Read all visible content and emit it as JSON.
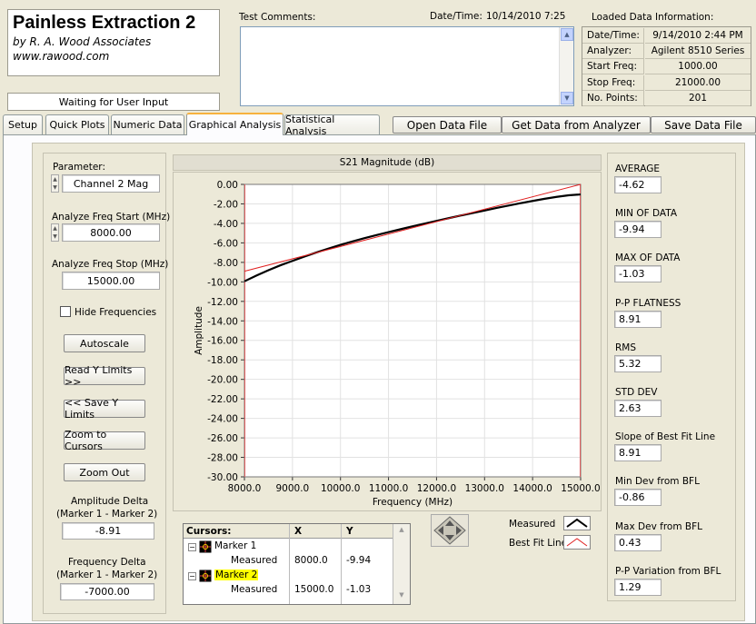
{
  "app": {
    "title": "Painless Extraction 2",
    "by": "by R. A. Wood Associates",
    "url": "www.rawood.com",
    "status": "Waiting for User Input"
  },
  "header": {
    "comments_label": "Test Comments:",
    "datetime_label": "Date/Time:",
    "datetime_value": "10/14/2010  7:25",
    "loaded_title": "Loaded Data Information:"
  },
  "loaded": [
    {
      "k": "Date/Time:",
      "v": "9/14/2010 2:44 PM"
    },
    {
      "k": "Analyzer:",
      "v": "Agilent 8510 Series"
    },
    {
      "k": "Start Freq:",
      "v": "1000.00"
    },
    {
      "k": "Stop Freq:",
      "v": "21000.00"
    },
    {
      "k": "No. Points:",
      "v": "201"
    }
  ],
  "tabs": [
    "Setup",
    "Quick Plots",
    "Numeric Data",
    "Graphical Analysis",
    "Statistical Analysis"
  ],
  "toolbar": {
    "open": "Open Data File",
    "get": "Get Data from Analyzer",
    "save": "Save Data File"
  },
  "left": {
    "param_label": "Parameter:",
    "param_value": "Channel 2 Mag",
    "start_label": "Analyze Freq Start (MHz)",
    "start_value": "8000.00",
    "stop_label": "Analyze Freq Stop (MHz)",
    "stop_value": "15000.00",
    "hide": "Hide Frequencies",
    "autoscale": "Autoscale",
    "read_y": "Read Y Limits >>",
    "save_y": "<< Save Y Limits",
    "zoom_cursors": "Zoom to Cursors",
    "zoom_out": "Zoom Out",
    "amp_delta_label1": "Amplitude Delta",
    "amp_delta_label2": "(Marker 1 - Marker 2)",
    "amp_delta": "-8.91",
    "freq_delta_label1": "Frequency Delta",
    "freq_delta_label2": "(Marker 1 - Marker 2)",
    "freq_delta": "-7000.00"
  },
  "chart_data": {
    "type": "line",
    "title": "S21 Magnitude (dB)",
    "xlabel": "Frequency (MHz)",
    "ylabel": "Amplitude",
    "xlim": [
      8000,
      15000
    ],
    "ylim": [
      -30,
      0
    ],
    "grid": true,
    "xticks": [
      "8000.0",
      "9000.0",
      "10000.0",
      "11000.0",
      "12000.0",
      "13000.0",
      "14000.0",
      "15000.0"
    ],
    "yticks": [
      "0.00",
      "-2.00",
      "-4.00",
      "-6.00",
      "-8.00",
      "-10.00",
      "-12.00",
      "-14.00",
      "-16.00",
      "-18.00",
      "-20.00",
      "-22.00",
      "-24.00",
      "-26.00",
      "-28.00",
      "-30.00"
    ],
    "series": [
      {
        "name": "Measured",
        "color": "#000000",
        "x": [
          8000,
          8250,
          8500,
          8750,
          9000,
          9250,
          9500,
          9750,
          10000,
          10250,
          10500,
          10750,
          11000,
          11250,
          11500,
          11750,
          12000,
          12250,
          12500,
          12750,
          13000,
          13250,
          13500,
          13750,
          14000,
          14250,
          14500,
          14750,
          15000
        ],
        "values": [
          -9.94,
          -9.35,
          -8.8,
          -8.3,
          -7.85,
          -7.4,
          -6.98,
          -6.58,
          -6.2,
          -5.85,
          -5.52,
          -5.2,
          -4.9,
          -4.6,
          -4.3,
          -4.02,
          -3.74,
          -3.47,
          -3.2,
          -2.94,
          -2.68,
          -2.42,
          -2.17,
          -1.93,
          -1.7,
          -1.48,
          -1.28,
          -1.12,
          -1.03
        ]
      },
      {
        "name": "Best Fit Line",
        "color": "#e02020",
        "x": [
          8000,
          15000
        ],
        "values": [
          -8.91,
          0.0
        ]
      }
    ]
  },
  "cursors": {
    "title": "Cursors:",
    "col_x": "X",
    "col_y": "Y",
    "m1": "Marker 1",
    "m2": "Marker 2",
    "measured": "Measured",
    "m1_x": "8000.0",
    "m1_y": "-9.94",
    "m2_x": "15000.0",
    "m2_y": "-1.03"
  },
  "legend": {
    "measured": "Measured",
    "bfl": "Best Fit Line"
  },
  "stats": [
    {
      "label": "AVERAGE",
      "value": "-4.62"
    },
    {
      "label": "MIN OF DATA",
      "value": "-9.94"
    },
    {
      "label": "MAX OF DATA",
      "value": "-1.03"
    },
    {
      "label": "P-P FLATNESS",
      "value": "8.91"
    },
    {
      "label": "RMS",
      "value": "5.32"
    },
    {
      "label": "STD DEV",
      "value": "2.63"
    },
    {
      "label": "Slope of Best Fit Line",
      "value": "8.91"
    },
    {
      "label": "Min Dev from BFL",
      "value": "-0.86"
    },
    {
      "label": "Max Dev from BFL",
      "value": "0.43"
    },
    {
      "label": "P-P Variation from BFL",
      "value": "1.29"
    }
  ]
}
